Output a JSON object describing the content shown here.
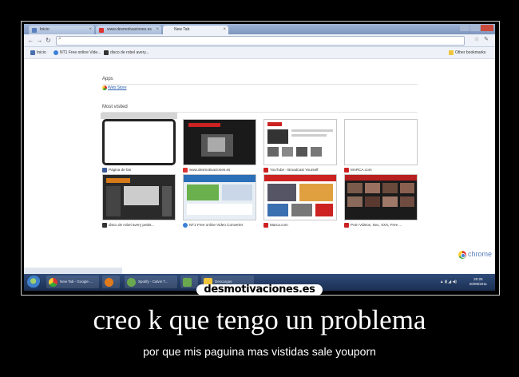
{
  "browser": {
    "tabs": [
      {
        "label": "Inicio",
        "active": false
      },
      {
        "label": "www.desmotivaciones.es",
        "active": false
      },
      {
        "label": "New Tab",
        "active": true
      }
    ],
    "omnibox": {
      "value": ""
    },
    "bookmarks": [
      {
        "label": "Inicio",
        "color": "#4a6fb0"
      },
      {
        "label": "NT1 Free online Vide...",
        "color": "#3a7fd8"
      },
      {
        "label": "disco de robel avery...",
        "color": "#333333"
      }
    ],
    "other_bookmarks": "Other bookmarks"
  },
  "newtab": {
    "apps_title": "Apps",
    "apps_link": "Web Store",
    "most_visited_title": "Most visited",
    "tiles": [
      {
        "caption": "Página de fan",
        "icon_color": "#3b5998",
        "thumb": "blank"
      },
      {
        "caption": "www.desmotivaciones.es",
        "icon_color": "#d33333",
        "thumb": "desmo"
      },
      {
        "caption": "YouTube - Broadcast Yourself",
        "icon_color": "#cc2222",
        "thumb": "youtube"
      },
      {
        "caption": "MARCA.com",
        "icon_color": "#cc2222",
        "thumb": "empty"
      },
      {
        "caption": "disco de robel avery petits...",
        "icon_color": "#333333",
        "thumb": "dark"
      },
      {
        "caption": "NT1 Free online Video Converter",
        "icon_color": "#3a7fd8",
        "thumb": "nt1"
      },
      {
        "caption": "Marca.com",
        "icon_color": "#cc2222",
        "thumb": "marca"
      },
      {
        "caption": "Porn Videos, Sex, XXX, Free ...",
        "icon_color": "#cc2222",
        "thumb": "porn"
      }
    ],
    "brand": "chrome"
  },
  "taskbar": {
    "items": [
      {
        "label": "New Tab - Google ...",
        "icon_color": "#3e8fd8"
      },
      {
        "label": "",
        "icon_color": "#e07a1c"
      },
      {
        "label": "Spotify - Calvin T...",
        "icon_color": "#6aa84f"
      },
      {
        "label": "",
        "icon_color": "#6aa84f"
      },
      {
        "label": "Descargas",
        "icon_color": "#f0c43c"
      }
    ],
    "clock_time": "20:25",
    "clock_date": "20/09/2011"
  },
  "watermark": "desmotivaciones.es",
  "poster": {
    "title": "creo k que tengo un problema",
    "subtitle": "por que mis paguina mas vistidas sale youporn"
  }
}
